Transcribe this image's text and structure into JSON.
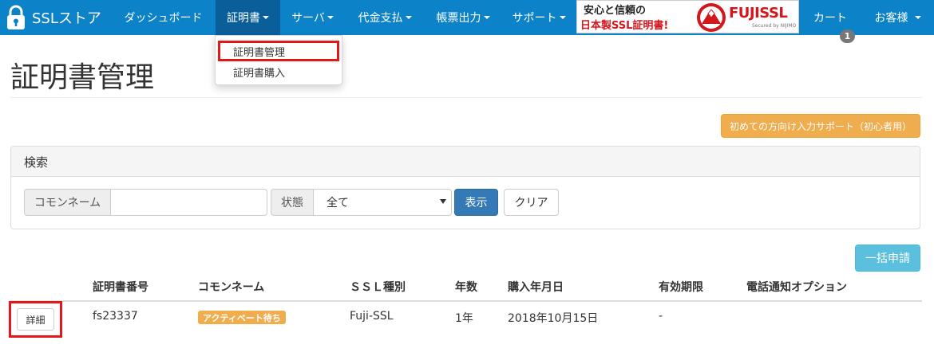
{
  "navbar": {
    "brand": "SSLストア",
    "items": [
      {
        "label": "ダッシュボード"
      },
      {
        "label": "証明書"
      },
      {
        "label": "サーバ"
      },
      {
        "label": "代金支払"
      },
      {
        "label": "帳票出力"
      },
      {
        "label": "サポート"
      }
    ],
    "banner": {
      "line1": "安心と信頼の",
      "line2": "日本製SSL証明書!",
      "logo": "FUJISSL",
      "tagline": "Secured by NIJIMO"
    },
    "cart_label": "カート",
    "cart_badge": "1",
    "user_label": "お客様"
  },
  "dropdown": {
    "items": [
      {
        "label": "証明書管理"
      },
      {
        "label": "証明書購入"
      }
    ]
  },
  "page": {
    "title": "証明書管理",
    "support_button": "初めての方向け入力サポート（初心者用）"
  },
  "search": {
    "panel_title": "検索",
    "common_name_label": "コモンネーム",
    "common_name_value": "",
    "status_label": "状態",
    "status_value": "全て",
    "show_button": "表示",
    "clear_button": "クリア"
  },
  "bulk_button": "一括申請",
  "table": {
    "headers": [
      "証明書番号",
      "コモンネーム",
      "ＳＳＬ種別",
      "年数",
      "購入年月日",
      "有効期限",
      "電話通知オプション"
    ],
    "rows": [
      {
        "detail_button": "詳細",
        "cert_no": "fs23337",
        "status": "アクティベート待ち",
        "ssl_type": "Fuji-SSL",
        "years": "1年",
        "purchase_date": "2018年10月15日",
        "expiry": "-",
        "phone_option": ""
      }
    ]
  },
  "colors": {
    "navbar": "#0c83c9",
    "navbar_active": "#0a5f9a",
    "highlight": "#e4171a",
    "warning": "#f0ad4e",
    "primary": "#337ab7",
    "info": "#5bc0de"
  },
  "icons": {
    "brand": "lock-icon",
    "caret": "caret-down-icon",
    "banner_seal": "fuji-seal-icon"
  }
}
